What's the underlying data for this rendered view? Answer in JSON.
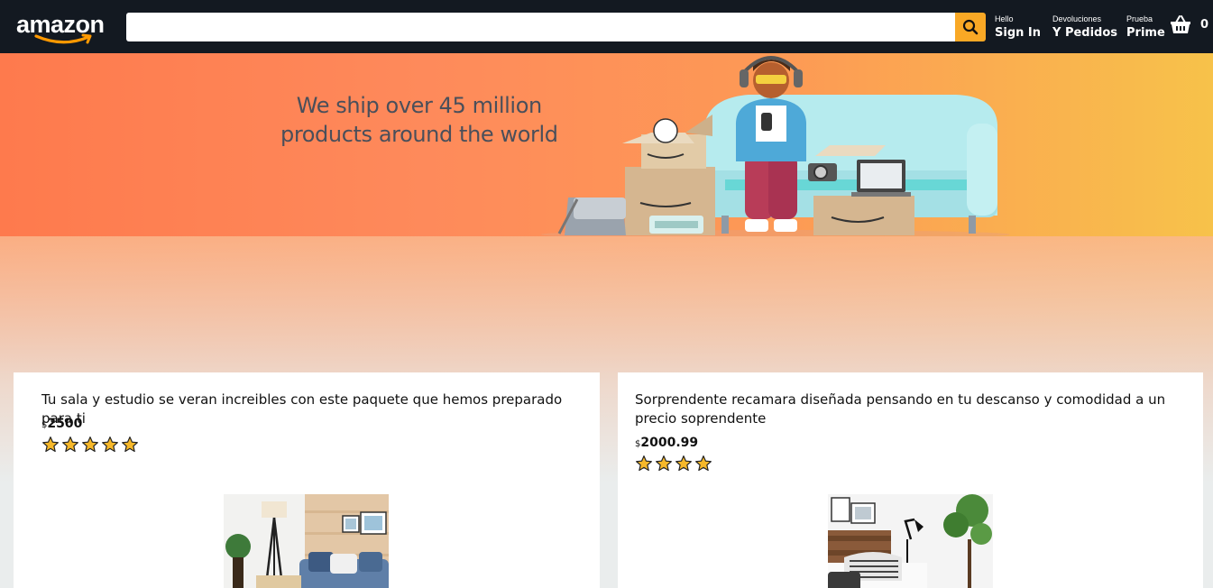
{
  "header": {
    "logo_text": "amazon",
    "search": {
      "value": "",
      "placeholder": ""
    },
    "nav": [
      {
        "line_one": "Hello",
        "line_two": "Sign In"
      },
      {
        "line_one": "Devoluciones",
        "line_two": "Y Pedidos"
      },
      {
        "line_one": "Prueba",
        "line_two": "Prime"
      }
    ],
    "basket_count": "0"
  },
  "hero": {
    "line1": "We ship over 45 million",
    "line2": "products around the world"
  },
  "products": [
    {
      "title": "Tu sala y estudio se veran increibles con este paquete que hemos preparado para ti",
      "currency": "$",
      "price": "2500",
      "rating": 5
    },
    {
      "title": "Sorprendente recamara diseñada pensando en tu descanso y comodidad a un precio soprendente",
      "currency": "$",
      "price": "2000.99",
      "rating": 4
    }
  ],
  "colors": {
    "header_bg": "#131921",
    "search_button": "#f9a825",
    "star": "#f6b82a",
    "logo_smile": "#f90"
  },
  "icons": [
    "search-icon",
    "basket-icon",
    "star-icon"
  ]
}
